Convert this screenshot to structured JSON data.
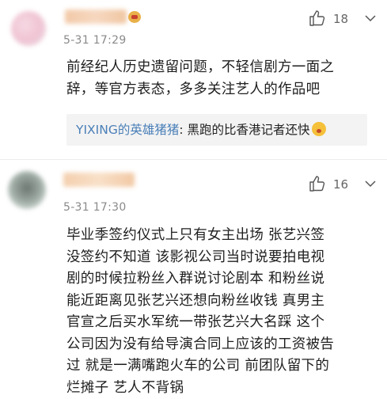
{
  "comments": [
    {
      "time": "5-31 17:29",
      "likes": "18",
      "text_lines": [
        "前经纪人历史遗留问题，不轻信剧方一面之",
        "辞，等官方表态，多多关注艺人的作品吧"
      ],
      "reply": {
        "user": "YIXING的英雄猪猪",
        "separator": ":",
        "text": " 黑跑的比香港记者还快"
      }
    },
    {
      "time": "5-31 17:30",
      "likes": "16",
      "text_lines": [
        "毕业季签约仪式上只有女主出场 张艺兴签",
        "没签约不知道 该影视公司当时说要拍电视",
        "剧的时候拉粉丝入群说讨论剧本 和粉丝说",
        "能近距离见张艺兴还想向粉丝收钱 真男主",
        "官宣之后买水军统一带张艺兴大名踩 这个",
        "公司因为没有给导演合同上应该的工资被告",
        "过 就是一满嘴跑火车的公司 前团队留下的",
        "烂摊子 艺人不背锅"
      ]
    }
  ],
  "colors": {
    "reply_user": "#4a7fb8",
    "reply_bg": "#f3f3f3",
    "meta_text": "#8a8a8a"
  },
  "icons": [
    "thumbs-up-icon",
    "more-options-icon",
    "emoji-icon",
    "vip-badge-icon"
  ]
}
